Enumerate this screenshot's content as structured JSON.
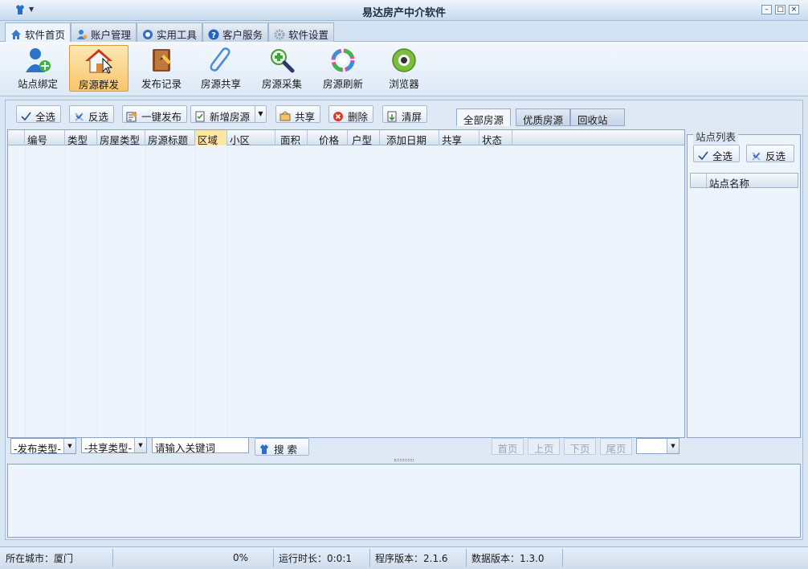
{
  "window": {
    "title": "易达房产中介软件"
  },
  "tabs": [
    {
      "label": "软件首页",
      "icon": "home-icon"
    },
    {
      "label": "账户管理",
      "icon": "user-icon"
    },
    {
      "label": "实用工具",
      "icon": "tools-icon"
    },
    {
      "label": "客户服务",
      "icon": "help-icon"
    },
    {
      "label": "软件设置",
      "icon": "gear-icon"
    }
  ],
  "bigbar": [
    {
      "label": "站点绑定",
      "icon": "user-add-icon"
    },
    {
      "label": "房源群发",
      "icon": "house-icon"
    },
    {
      "label": "发布记录",
      "icon": "notebook-icon"
    },
    {
      "label": "房源共享",
      "icon": "paperclip-icon"
    },
    {
      "label": "房源采集",
      "icon": "magnifier-icon"
    },
    {
      "label": "房源刷新",
      "icon": "refresh-icon"
    },
    {
      "label": "浏览器",
      "icon": "browser-icon"
    }
  ],
  "toolbar": {
    "select_all": "全选",
    "invert": "反选",
    "publish": "一键发布",
    "add": "新增房源",
    "share": "共享",
    "delete": "删除",
    "clear": "清屏"
  },
  "views": [
    "全部房源",
    "优质房源",
    "回收站"
  ],
  "grid": {
    "columns": [
      "编号",
      "类型",
      "房屋类型",
      "房源标题",
      "区域",
      "小区",
      "面积",
      "价格",
      "户型",
      "添加日期",
      "共享",
      "状态"
    ]
  },
  "sitelist": {
    "title": "站点列表",
    "select_all": "全选",
    "invert": "反选",
    "column": "站点名称"
  },
  "search": {
    "publish_type": "-发布类型-",
    "share_type": "-共享类型-",
    "keyword": "请输入关键词",
    "button": "搜 索"
  },
  "pager": {
    "first": "首页",
    "prev": "上页",
    "next": "下页",
    "last": "尾页"
  },
  "status": {
    "city": "所在城市：厦门",
    "progress": "0%",
    "runtime": "运行时长：0:0:1",
    "app_version": "程序版本：2.1.6",
    "data_version": "数据版本：1.3.0"
  },
  "colors": {
    "accent": "#f9c56a",
    "panel": "#dfe9f5",
    "grid_bg": "#eef4fb"
  }
}
